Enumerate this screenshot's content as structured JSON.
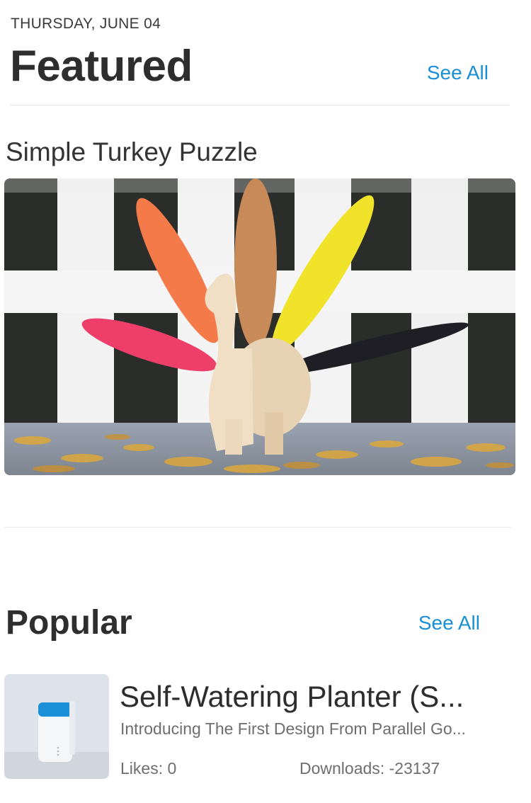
{
  "header": {
    "date": "THURSDAY, JUNE 04",
    "featured_title": "Featured",
    "see_all": "See All"
  },
  "featured_item": {
    "title": "Simple Turkey Puzzle",
    "image_alt": "wooden turkey puzzle with colorful feathers in front of white fence"
  },
  "popular": {
    "title": "Popular",
    "see_all": "See All",
    "items": [
      {
        "title": "Self-Watering Planter (S...",
        "description": "Introducing The First Design From Parallel Go...",
        "likes": "Likes: 0",
        "downloads": "Downloads: -23137"
      }
    ]
  },
  "colors": {
    "accent": "#1a8fd6",
    "feather_orange": "#f47a4a",
    "feather_tan": "#c98a5a",
    "feather_yellow": "#f1e22a",
    "feather_pink": "#ee3f6b",
    "feather_black": "#1e1e24",
    "planter_blue": "#1b8fd8"
  }
}
